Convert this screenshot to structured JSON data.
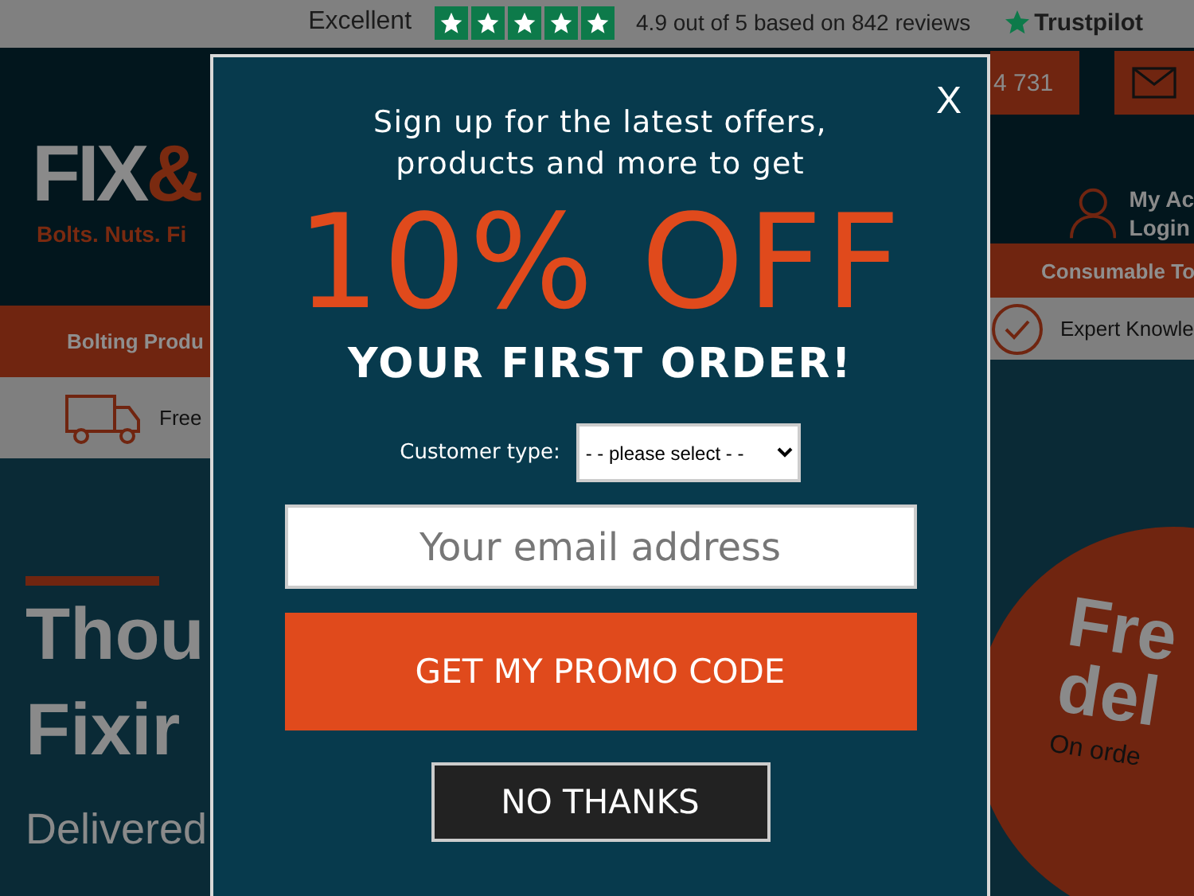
{
  "trust_bar": {
    "rating_label": "Excellent",
    "stars": 5,
    "score_text": "4.9 out of 5 based on 842 reviews",
    "brand": "Trustpilot"
  },
  "background_left": {
    "logo_main": "FIX",
    "logo_amp": "&",
    "tagline": "Bolts. Nuts. Fi",
    "nav_item": "Bolting Produ",
    "feature": "Free",
    "headline": [
      "Thou",
      "Fixir"
    ],
    "subheadline": "Delivered"
  },
  "background_right": {
    "phone": "4 731",
    "account": "My Ac",
    "login": "Login",
    "nav_item": "Consumable To",
    "feature": "Expert Knowle",
    "badge_lines": [
      "Fre",
      "del"
    ],
    "badge_note": "On orde"
  },
  "modal": {
    "close": "X",
    "intro_lines": [
      "Sign up for the latest offers,",
      "products and more to get"
    ],
    "offer": "10% OFF",
    "offer_sub": "YOUR FIRST ORDER!",
    "customer_type_label": "Customer type:",
    "customer_type_value": "- - please select - -",
    "email_placeholder": "Your email address",
    "submit": "GET MY PROMO CODE",
    "decline": "NO THANKS"
  }
}
